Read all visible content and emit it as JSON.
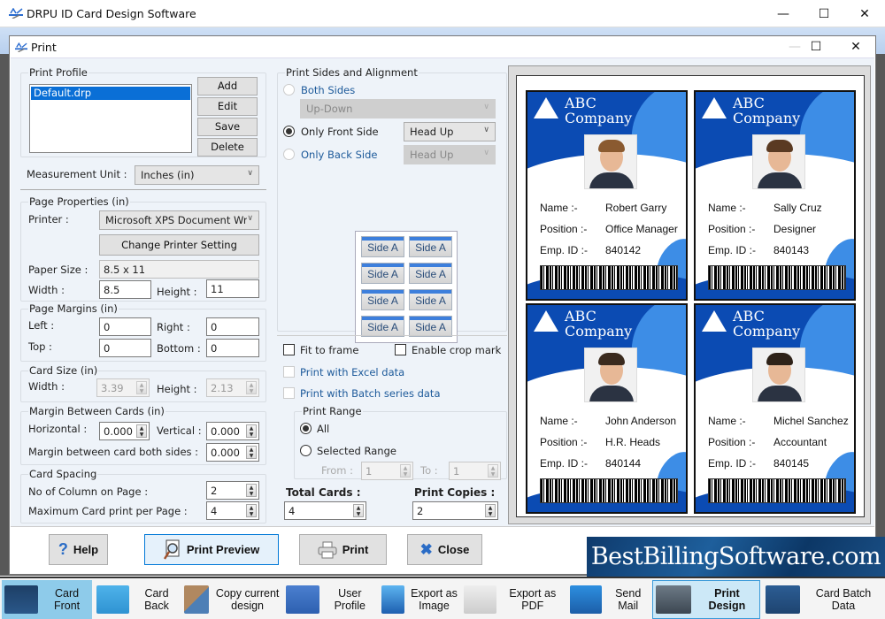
{
  "app": {
    "title": "DRPU ID Card Design Software",
    "window_controls": {
      "minimize": "—",
      "maximize": "☐",
      "close": "✕"
    }
  },
  "dialog": {
    "title": "Print",
    "print_profile": {
      "label": "Print Profile",
      "items": [
        "Default.drp"
      ],
      "selected": "Default.drp",
      "buttons": {
        "add": "Add",
        "edit": "Edit",
        "save": "Save",
        "delete": "Delete"
      }
    },
    "measurement_unit": {
      "label": "Measurement Unit :",
      "value": "Inches (in)"
    },
    "page_properties": {
      "label": "Page Properties (in)",
      "printer_label": "Printer :",
      "printer_value": "Microsoft XPS Document Wr",
      "change_printer_button": "Change Printer Setting",
      "paper_size_label": "Paper Size :",
      "paper_size_value": "8.5 x 11",
      "width_label": "Width :",
      "width_value": "8.5",
      "height_label": "Height :",
      "height_value": "11"
    },
    "page_margins": {
      "label": "Page Margins (in)",
      "left_label": "Left :",
      "left_value": "0",
      "right_label": "Right :",
      "right_value": "0",
      "top_label": "Top :",
      "top_value": "0",
      "bottom_label": "Bottom :",
      "bottom_value": "0"
    },
    "card_size": {
      "label": "Card Size (in)",
      "width_label": "Width :",
      "width_value": "3.39",
      "height_label": "Height :",
      "height_value": "2.13"
    },
    "margin_between_cards": {
      "label": "Margin Between Cards (in)",
      "horizontal_label": "Horizontal :",
      "horizontal_value": "0.000",
      "vertical_label": "Vertical :",
      "vertical_value": "0.000",
      "both_sides_label": "Margin between card both sides :",
      "both_sides_value": "0.000"
    },
    "card_spacing": {
      "label": "Card Spacing",
      "columns_label": "No of Column on Page :",
      "columns_value": "2",
      "max_label": "Maximum Card print per Page :",
      "max_value": "4"
    },
    "print_sides": {
      "label": "Print Sides and Alignment",
      "both_sides": "Both Sides",
      "both_sides_option": "Up-Down",
      "front_side": "Only Front Side",
      "front_side_option": "Head Up",
      "back_side": "Only Back Side",
      "back_side_option": "Head Up",
      "selected": "Only Front Side",
      "side_tiles": [
        "Side A",
        "Side A",
        "Side A",
        "Side A",
        "Side A",
        "Side A",
        "Side A",
        "Side A"
      ]
    },
    "options": {
      "fit_to_frame": "Fit to frame",
      "enable_crop_mark": "Enable crop mark",
      "print_excel": "Print with Excel data",
      "print_batch": "Print with Batch series data"
    },
    "print_range": {
      "label": "Print Range",
      "all": "All",
      "selected_range": "Selected Range",
      "from_label": "From :",
      "from_value": "1",
      "to_label": "To :",
      "to_value": "1",
      "selected": "All"
    },
    "total_cards": {
      "label": "Total Cards :",
      "value": "4"
    },
    "print_copies": {
      "label": "Print Copies :",
      "value": "2"
    },
    "preview_cards": [
      {
        "company_line1": "ABC",
        "company_line2": "Company",
        "name_label": "Name :-",
        "name": "Robert Garry",
        "position_label": "Position :-",
        "position": "Office Manager",
        "id_label": "Emp. ID :-",
        "emp_id": "840142"
      },
      {
        "company_line1": "ABC",
        "company_line2": "Company",
        "name_label": "Name :-",
        "name": "Sally Cruz",
        "position_label": "Position :-",
        "position": "Designer",
        "id_label": "Emp. ID :-",
        "emp_id": "840143"
      },
      {
        "company_line1": "ABC",
        "company_line2": "Company",
        "name_label": "Name :-",
        "name": "John Anderson",
        "position_label": "Position :-",
        "position": "H.R. Heads",
        "id_label": "Emp. ID :-",
        "emp_id": "840144"
      },
      {
        "company_line1": "ABC",
        "company_line2": "Company",
        "name_label": "Name :-",
        "name": "Michel Sanchez",
        "position_label": "Position :-",
        "position": "Accountant",
        "id_label": "Emp. ID :-",
        "emp_id": "840145"
      }
    ],
    "footer": {
      "help": "Help",
      "print_preview": "Print Preview",
      "print": "Print",
      "close": "Close"
    }
  },
  "brand_banner": "BestBillingSoftware.com",
  "taskbar": [
    {
      "label": "Card Front",
      "icon": "card-front-icon"
    },
    {
      "label": "Card Back",
      "icon": "card-back-icon"
    },
    {
      "label": "Copy current design",
      "icon": "copy-design-icon"
    },
    {
      "label": "User Profile",
      "icon": "user-profile-icon"
    },
    {
      "label": "Export as Image",
      "icon": "export-image-icon"
    },
    {
      "label": "Export as PDF",
      "icon": "export-pdf-icon"
    },
    {
      "label": "Send Mail",
      "icon": "send-mail-icon"
    },
    {
      "label": "Print Design",
      "icon": "printer-icon"
    },
    {
      "label": "Card Batch Data",
      "icon": "batch-data-icon"
    }
  ],
  "colors": {
    "accent": "#0a6fd6",
    "card_blue": "#0b4bb3",
    "card_light_blue": "#3d8de6",
    "active_tab": "#8ecbea"
  }
}
